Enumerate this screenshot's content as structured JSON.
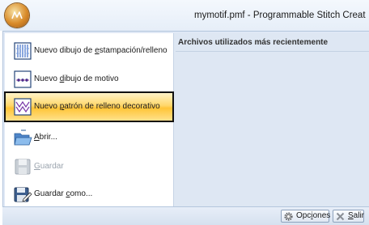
{
  "window": {
    "title": "mymotif.pmf - Programmable Stitch Creat"
  },
  "menu": {
    "items": [
      {
        "pre": "Nuevo dibujo de ",
        "key": "e",
        "post": "stampación/relleno",
        "icon": "stamp-fill-icon",
        "state": "normal"
      },
      {
        "pre": "Nuevo ",
        "key": "d",
        "post": "ibujo de motivo",
        "icon": "motif-icon",
        "state": "normal"
      },
      {
        "pre": "Nuevo ",
        "key": "p",
        "post": "atrón de relleno decorativo",
        "icon": "decorative-fill-icon",
        "state": "highlighted"
      },
      {
        "pre": "",
        "key": "A",
        "post": "brir...",
        "icon": "open-folder-icon",
        "state": "normal"
      },
      {
        "pre": "",
        "key": "G",
        "post": "uardar",
        "icon": "save-icon",
        "state": "disabled"
      },
      {
        "pre": "Guardar ",
        "key": "c",
        "post": "omo...",
        "icon": "save-as-icon",
        "state": "normal"
      }
    ]
  },
  "recent": {
    "header": "Archivos utilizados más recientemente"
  },
  "buttons": {
    "options": {
      "pre": "Opc",
      "key": "i",
      "post": "ones",
      "icon": "gear-icon"
    },
    "exit": {
      "pre": "",
      "key": "S",
      "post": "alir",
      "icon": "close-x-icon"
    }
  },
  "colors": {
    "highlight": "#ffc437",
    "highlight_border": "#111111",
    "pane_bg": "#dee7f3",
    "accent_blue": "#1f4e9e"
  }
}
